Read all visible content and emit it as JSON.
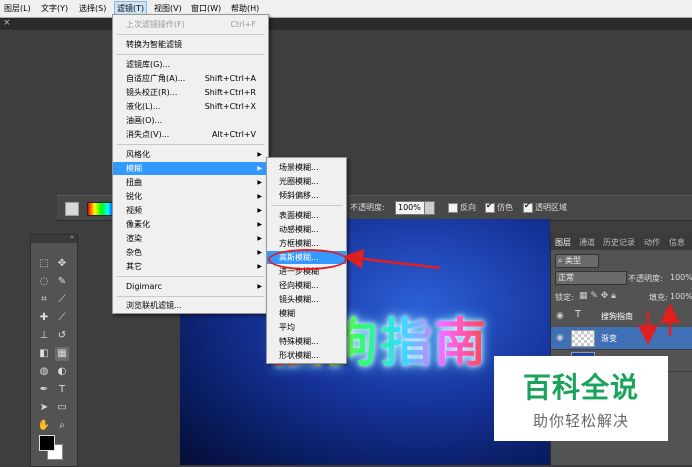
{
  "menubar": {
    "items": [
      "图层(L)",
      "文字(Y)",
      "选择(S)",
      "滤镜(T)",
      "视图(V)",
      "窗口(W)",
      "帮助(H)"
    ],
    "active_index": 3
  },
  "doc_strip": {
    "close": "×"
  },
  "filter_menu": {
    "last_filter": "上次滤镜操作(F)",
    "last_filter_shortcut": "Ctrl+F",
    "convert_smart": "转换为智能滤镜",
    "gallery": "滤镜库(G)...",
    "adaptive_wide": "自适应广角(A)...",
    "adaptive_wide_shortcut": "Shift+Ctrl+A",
    "lens_correction": "镜头校正(R)...",
    "lens_correction_shortcut": "Shift+Ctrl+R",
    "liquify": "液化(L)...",
    "liquify_shortcut": "Shift+Ctrl+X",
    "oil_paint": "油画(O)...",
    "vanishing_point": "消失点(V)...",
    "vanishing_point_shortcut": "Alt+Ctrl+V",
    "stylize": "风格化",
    "blur": "模糊",
    "distort": "扭曲",
    "sharpen": "锐化",
    "video": "视频",
    "pixelate": "像素化",
    "render": "渲染",
    "noise": "杂色",
    "other": "其它",
    "digimarc": "Digimarc",
    "browse_online": "浏览联机滤镜..."
  },
  "blur_menu": {
    "items": [
      "场景模糊...",
      "光圈模糊...",
      "倾斜偏移...",
      "表面模糊...",
      "动感模糊...",
      "方框模糊...",
      "高斯模糊...",
      "进一步模糊",
      "径向模糊...",
      "镜头模糊...",
      "模糊",
      "平均",
      "特殊模糊...",
      "形状模糊..."
    ],
    "highlighted_index": 6
  },
  "options_bar": {
    "opacity_label": "不透明度:",
    "opacity_value": "100%",
    "reverse": "反向",
    "dither": "仿色",
    "transparency": "透明区域",
    "dither_checked": true,
    "transparency_checked": true,
    "reverse_checked": false
  },
  "canvas": {
    "text": "搜狗指南"
  },
  "layers_panel": {
    "tabs": [
      "图层",
      "通道",
      "历史记录",
      "动作",
      "信息"
    ],
    "kind": "类型",
    "blend_mode": "正常",
    "opacity_label": "不透明度:",
    "opacity_value": "100%",
    "lock_label": "锁定:",
    "fill_label": "填充:",
    "fill_value": "100%",
    "layers": [
      {
        "name": "搜狗指南",
        "type": "text"
      },
      {
        "name": "渐变",
        "type": "gradient"
      },
      {
        "name": "背景",
        "type": "background"
      }
    ],
    "selected_index": 1
  },
  "watermark": {
    "title": "百科全说",
    "subtitle": "助你轻松解决"
  },
  "colors": {
    "accent": "#3399ff",
    "annotation": "#e02020",
    "watermark_green": "#1aa35a"
  }
}
